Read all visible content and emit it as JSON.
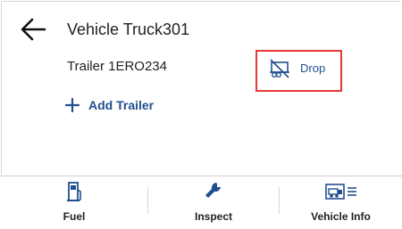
{
  "header": {
    "title": "Vehicle Truck301",
    "back_icon": "arrow-left-icon"
  },
  "trailer": {
    "label": "Trailer 1ERO234",
    "drop_button": {
      "label": "Drop",
      "icon": "trailer-drop-icon",
      "highlight_color": "#e53935"
    }
  },
  "add_trailer": {
    "label": "Add Trailer",
    "icon": "plus-icon"
  },
  "bottom_tabs": [
    {
      "label": "Fuel",
      "icon": "fuel-pump-icon"
    },
    {
      "label": "Inspect",
      "icon": "wrench-icon"
    },
    {
      "label": "Vehicle Info",
      "icon": "truck-info-icon"
    }
  ],
  "colors": {
    "accent": "#1f4f8f",
    "highlight": "#e53935",
    "text": "#222222"
  }
}
